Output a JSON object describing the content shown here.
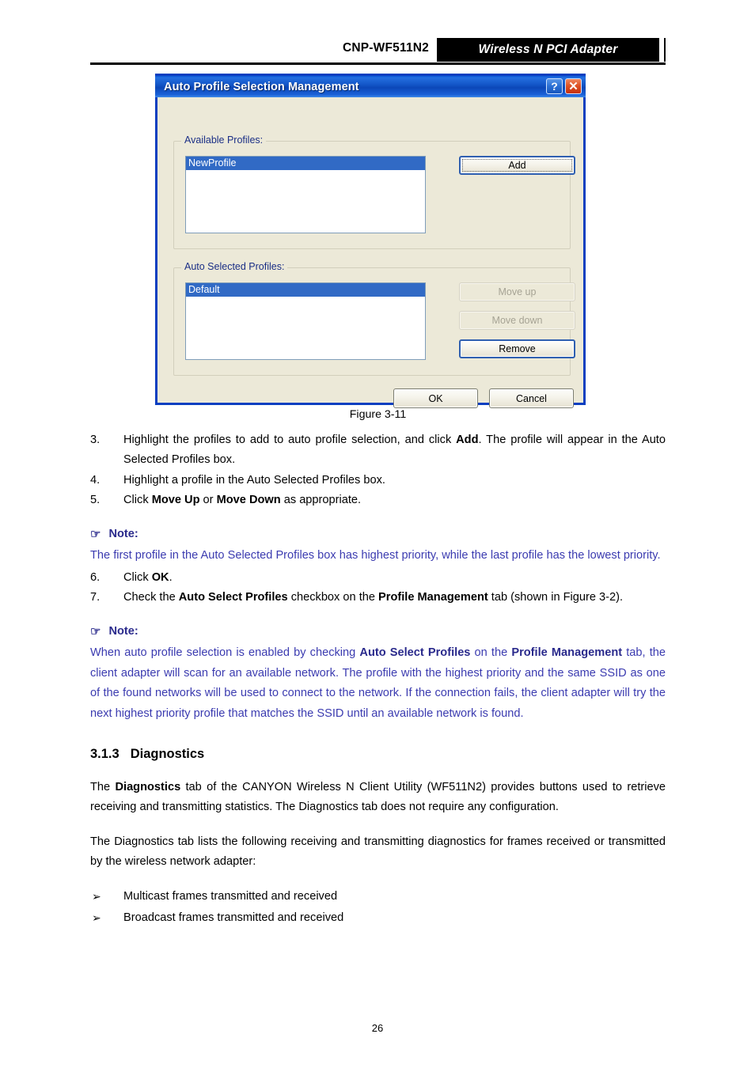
{
  "header": {
    "model": "CNP-WF511N2",
    "product": "Wireless N PCI Adapter"
  },
  "dialog": {
    "title": "Auto Profile Selection Management",
    "help_button": "?",
    "close_button": "✕",
    "available_group_label": "Available Profiles:",
    "available_profiles": [
      "NewProfile"
    ],
    "add_button": "Add",
    "auto_group_label": "Auto Selected Profiles:",
    "auto_selected_profiles": [
      "Default"
    ],
    "move_up_button": "Move up",
    "move_down_button": "Move down",
    "remove_button": "Remove",
    "ok_button": "OK",
    "cancel_button": "Cancel",
    "accent_titlebar": "#0a3fc0",
    "accent_selection": "#316ac5",
    "face_color": "#ece9d8"
  },
  "document": {
    "figure_caption": "Figure 3-11",
    "steps": [
      {
        "num": "3.",
        "parts": [
          {
            "t": "Highlight the profiles to add to auto profile selection, and click ",
            "b": false
          },
          {
            "t": "Add",
            "b": true
          },
          {
            "t": ". The profile will appear in the Auto Selected Profiles box.",
            "b": false
          }
        ]
      },
      {
        "num": "4.",
        "parts": [
          {
            "t": "Highlight a profile in the Auto Selected Profiles box.",
            "b": false
          }
        ]
      },
      {
        "num": "5.",
        "parts": [
          {
            "t": "Click ",
            "b": false
          },
          {
            "t": "Move Up",
            "b": true
          },
          {
            "t": " or ",
            "b": false
          },
          {
            "t": "Move Down",
            "b": true
          },
          {
            "t": " as appropriate.",
            "b": false
          }
        ]
      }
    ],
    "note1": {
      "glyph": "☞",
      "label": "Note:",
      "body": "The first profile in the Auto Selected Profiles box has highest priority, while the last profile has the lowest priority."
    },
    "steps2": [
      {
        "num": "6.",
        "parts": [
          {
            "t": "Click ",
            "b": false
          },
          {
            "t": "OK",
            "b": true
          },
          {
            "t": ".",
            "b": false
          }
        ]
      },
      {
        "num": "7.",
        "parts": [
          {
            "t": "Check the ",
            "b": false
          },
          {
            "t": "Auto Select Profiles",
            "b": true
          },
          {
            "t": " checkbox on the ",
            "b": false
          },
          {
            "t": "Profile Management",
            "b": true
          },
          {
            "t": " tab (shown in Figure 3-2).",
            "b": false
          }
        ]
      }
    ],
    "note2": {
      "glyph": "☞",
      "label": "Note:",
      "parts": [
        {
          "t": "When auto profile selection is enabled by checking ",
          "b": false
        },
        {
          "t": "Auto Select Profiles",
          "b": true
        },
        {
          "t": " on the ",
          "b": false
        },
        {
          "t": "Profile Management",
          "b": true
        },
        {
          "t": " tab, the client adapter will scan for an available network. The profile with the highest priority and the same SSID as one of the found networks will be used to connect to the network. If the connection fails, the client adapter will try the next highest priority profile that matches the SSID until an available network is found.",
          "b": false
        }
      ]
    },
    "section": {
      "number": "3.1.3",
      "title": "Diagnostics"
    },
    "para1": [
      {
        "t": "The ",
        "b": false
      },
      {
        "t": "Diagnostics",
        "b": true
      },
      {
        "t": " tab of the CANYON Wireless N Client Utility (WF511N2) provides buttons used to retrieve receiving and transmitting statistics. The Diagnostics tab does not require any configuration.",
        "b": false
      }
    ],
    "para2": [
      {
        "t": "The Diagnostics tab lists the following receiving and transmitting diagnostics for frames received or transmitted by the wireless network adapter:",
        "b": false
      }
    ],
    "bullet_glyph": "➢",
    "bullets": [
      "Multicast frames transmitted and received",
      "Broadcast frames transmitted and received"
    ],
    "page_number": "26"
  }
}
